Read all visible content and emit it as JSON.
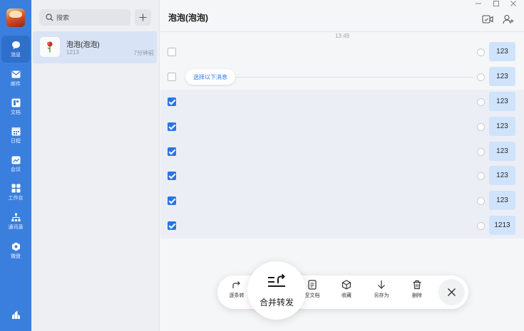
{
  "nav": {
    "items": [
      {
        "label": "消息",
        "icon": "chat-bubble-icon"
      },
      {
        "label": "邮件",
        "icon": "mail-icon"
      },
      {
        "label": "文档",
        "icon": "document-icon"
      },
      {
        "label": "日程",
        "icon": "calendar-icon"
      },
      {
        "label": "会议",
        "icon": "meeting-icon"
      },
      {
        "label": "工作台",
        "icon": "workbench-icon"
      },
      {
        "label": "通讯录",
        "icon": "contacts-icon"
      },
      {
        "label": "微盘",
        "icon": "cloud-drive-icon"
      }
    ]
  },
  "search": {
    "placeholder": "搜索"
  },
  "conversation": {
    "name": "泡泡(泡泡)",
    "last_message": "1213",
    "time": "7分钟前"
  },
  "chat": {
    "title": "泡泡(泡泡)",
    "timestamp": "13:49",
    "select_below_label": "选择以下消息",
    "messages": [
      {
        "text": "123",
        "checked": false
      },
      {
        "text": "123",
        "checked": false
      },
      {
        "text": "123",
        "checked": true
      },
      {
        "text": "123",
        "checked": true
      },
      {
        "text": "123",
        "checked": true
      },
      {
        "text": "123",
        "checked": true
      },
      {
        "text": "123",
        "checked": true
      },
      {
        "text": "1213",
        "checked": true
      }
    ]
  },
  "toolbar": {
    "forward_one_by_one": "逐条转",
    "merge_forward": "合并转发",
    "save_to_doc": "至文档",
    "favorite": "收藏",
    "save_as": "另存为",
    "delete": "删除"
  },
  "colors": {
    "nav_bg": "#3b7fde",
    "accent": "#2a74e6",
    "bubble": "#cfe3fb",
    "selected_row": "#eceef5"
  }
}
